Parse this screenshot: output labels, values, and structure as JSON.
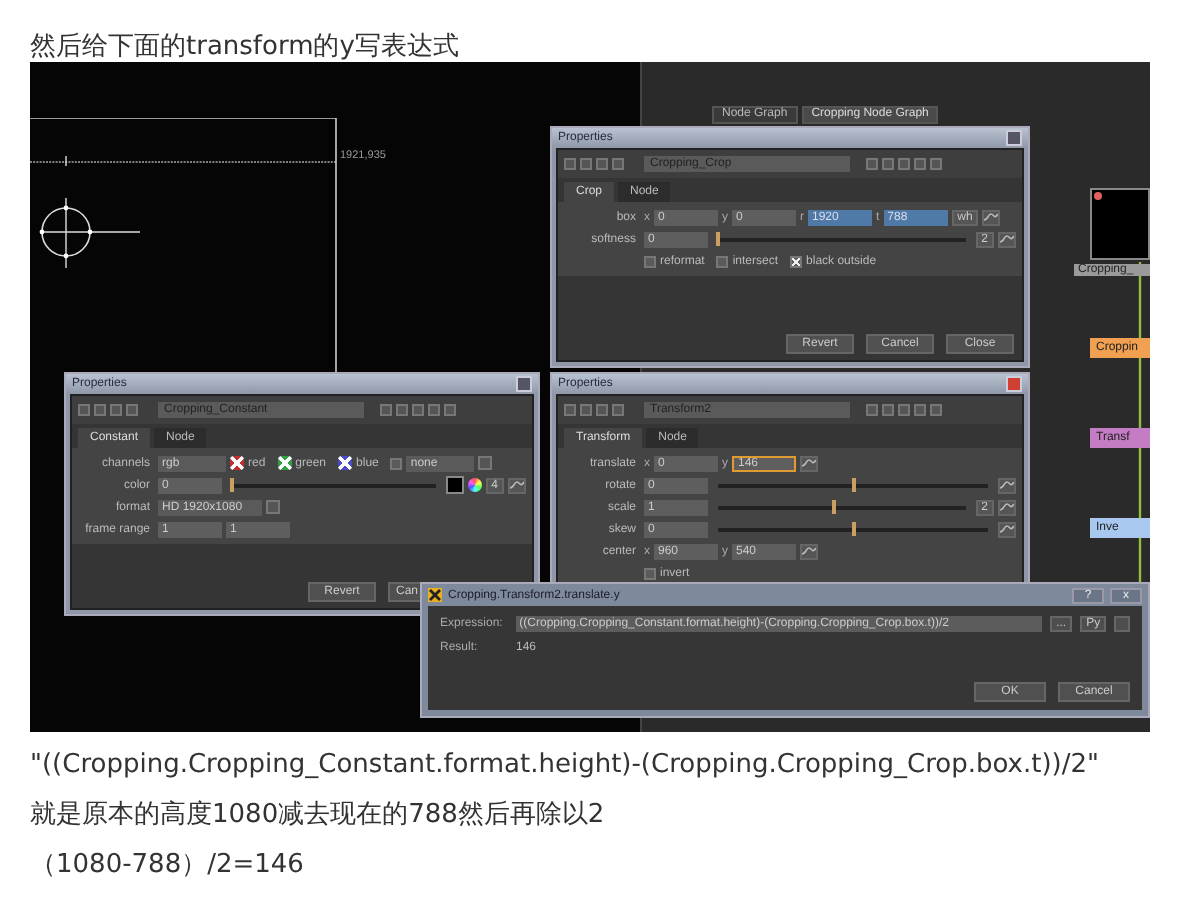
{
  "heading": "然后给下面的transform的y写表达式",
  "screenshot": {
    "viewer": {
      "coordinate_label": "1921,935"
    },
    "node_graph": {
      "tabs": [
        {
          "label": "Node Graph",
          "selected": false
        },
        {
          "label": "Cropping Node Graph",
          "selected": true
        }
      ],
      "nodes": [
        {
          "kind": "thumbnail",
          "label": "Cropping_",
          "color": "#9a9a9a"
        },
        {
          "kind": "plain",
          "label": "Croppin",
          "color": "#f0a050"
        },
        {
          "kind": "plain",
          "label": "Transf",
          "color": "#c47cc4"
        },
        {
          "kind": "plain",
          "label": "Inve",
          "color": "#a8c8f0"
        }
      ]
    },
    "windows": [
      {
        "title": "Properties",
        "active": false,
        "node_name": "Cropping_Crop",
        "tabs": [
          {
            "label": "Crop",
            "selected": true
          },
          {
            "label": "Node",
            "selected": false
          }
        ],
        "knobs": [
          {
            "kind": "fields",
            "label": "box",
            "fields": [
              {
                "prefix": "x",
                "value": "0",
                "selected": false
              },
              {
                "prefix": "y",
                "value": "0",
                "selected": false
              },
              {
                "prefix": "r",
                "value": "1920",
                "selected": true
              },
              {
                "prefix": "t",
                "value": "788",
                "selected": true
              }
            ],
            "button": "wh",
            "curve_button": true
          },
          {
            "kind": "slider",
            "label": "softness",
            "value": "0",
            "level": 0,
            "end_value": "2",
            "curve_button": true
          },
          {
            "kind": "checkboxes",
            "items": [
              {
                "label": "reformat",
                "checked": false
              },
              {
                "label": "intersect",
                "checked": false
              },
              {
                "label": "black outside",
                "checked": true
              }
            ]
          }
        ],
        "buttons": [
          "Revert",
          "Cancel",
          "Close"
        ]
      },
      {
        "title": "Properties",
        "active": false,
        "node_name": "Cropping_Constant",
        "tabs": [
          {
            "label": "Constant",
            "selected": true
          },
          {
            "label": "Node",
            "selected": false
          }
        ],
        "knobs": [
          {
            "kind": "channels",
            "label": "channels",
            "dropdown": "rgb",
            "items": [
              {
                "label": "red",
                "checked": true,
                "color": "#c03030"
              },
              {
                "label": "green",
                "checked": true,
                "color": "#30a040"
              },
              {
                "label": "blue",
                "checked": true,
                "color": "#4a4ac8"
              }
            ],
            "extra_checked": false,
            "dropdown_2": "none"
          },
          {
            "kind": "color",
            "label": "color",
            "value": "0",
            "level": 0,
            "end_value": "4",
            "curve_button": true
          },
          {
            "kind": "dropdown",
            "label": "format",
            "value": "HD 1920x1080"
          },
          {
            "kind": "fields",
            "label": "frame range",
            "fields": [
              {
                "value": "1",
                "selected": false
              },
              {
                "value": "1",
                "selected": false
              }
            ],
            "curve_button": false
          }
        ],
        "buttons": [
          "Revert",
          "Can"
        ]
      },
      {
        "title": "Properties",
        "active": true,
        "node_name": "Transform2",
        "tabs": [
          {
            "label": "Transform",
            "selected": true
          },
          {
            "label": "Node",
            "selected": false
          }
        ],
        "knobs": [
          {
            "kind": "fields",
            "label": "translate",
            "fields": [
              {
                "prefix": "x",
                "value": "0",
                "focused": false
              },
              {
                "prefix": "y",
                "value": "146",
                "focused": true
              }
            ],
            "curve_button": true
          },
          {
            "kind": "slider",
            "label": "rotate",
            "value": "0",
            "level": 0.5,
            "curve_button": true
          },
          {
            "kind": "slider",
            "label": "scale",
            "value": "1",
            "level": 0.47,
            "end_value": "2",
            "curve_button": true
          },
          {
            "kind": "slider",
            "label": "skew",
            "value": "0",
            "level": 0.5,
            "curve_button": true
          },
          {
            "kind": "fields",
            "label": "center",
            "fields": [
              {
                "prefix": "x",
                "value": "960",
                "focused": false
              },
              {
                "prefix": "y",
                "value": "540",
                "focused": false
              }
            ],
            "curve_button": true
          },
          {
            "kind": "checkboxes",
            "items": [
              {
                "label": "invert",
                "checked": false
              }
            ]
          }
        ]
      }
    ],
    "expression_dialog": {
      "title": "Cropping.Transform2.translate.y",
      "help": "?",
      "close": "x",
      "expression_label": "Expression:",
      "expression": "((Cropping.Cropping_Constant.format.height)-(Cropping.Cropping_Crop.box.t))/2",
      "side_buttons": [
        "...",
        "Py"
      ],
      "result_label": "Result:",
      "result": "146",
      "buttons": [
        "OK",
        "Cancel"
      ]
    }
  },
  "expression_quote": "\"((Cropping.Cropping_Constant.format.height)-(Cropping.Cropping_Crop.box.t))/2\"",
  "explanation": "就是原本的高度1080减去现在的788然后再除以2",
  "calculation": "（1080-788）/2=146"
}
